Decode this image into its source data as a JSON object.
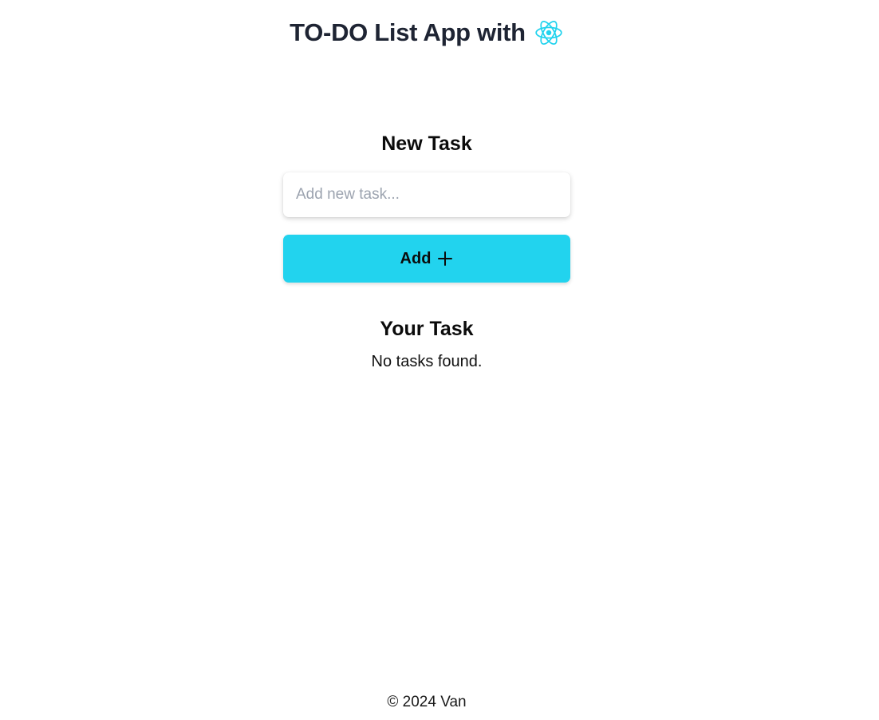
{
  "header": {
    "title": "TO-DO List App with",
    "logo_icon": "react-logo-icon",
    "accent_color": "#22d3ee"
  },
  "new_task": {
    "heading": "New Task",
    "input_placeholder": "Add new task...",
    "input_value": "",
    "add_button_label": "Add",
    "add_button_icon": "plus-icon",
    "add_button_color": "#22d3ee"
  },
  "task_list": {
    "heading": "Your Task",
    "empty_message": "No tasks found."
  },
  "footer": {
    "copyright": "© 2024 Van"
  }
}
